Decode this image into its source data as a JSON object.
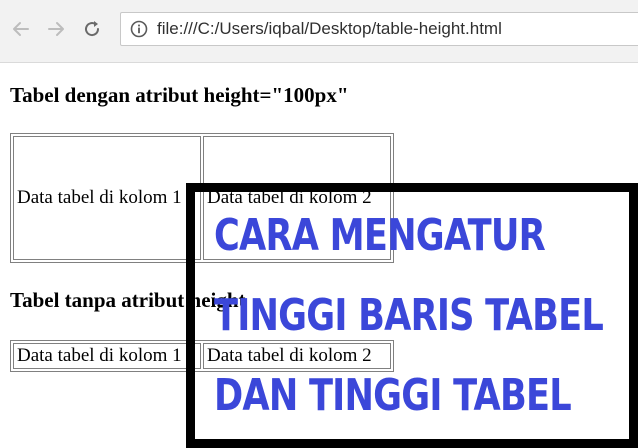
{
  "browser": {
    "url": "file:///C:/Users/iqbal/Desktop/table-height.html"
  },
  "page": {
    "heading_1": "Tabel dengan atribut height=\"100px\"",
    "table_1": {
      "cells": [
        "Data tabel di kolom 1",
        "Data tabel di kolom 2"
      ]
    },
    "heading_2": "Tabel tanpa atribut height",
    "table_2": {
      "cells": [
        "Data tabel di kolom 1",
        "Data tabel di kolom 2"
      ]
    }
  },
  "overlay": {
    "lines": [
      "Cara mengatur",
      "tinggi baris tabel",
      "dan tinggi tabel"
    ],
    "text_color": "#3b47d9",
    "border_color": "#000000"
  },
  "icons": {
    "back": "arrow-left-icon",
    "forward": "arrow-right-icon",
    "reload": "reload-icon",
    "info": "info-icon"
  }
}
